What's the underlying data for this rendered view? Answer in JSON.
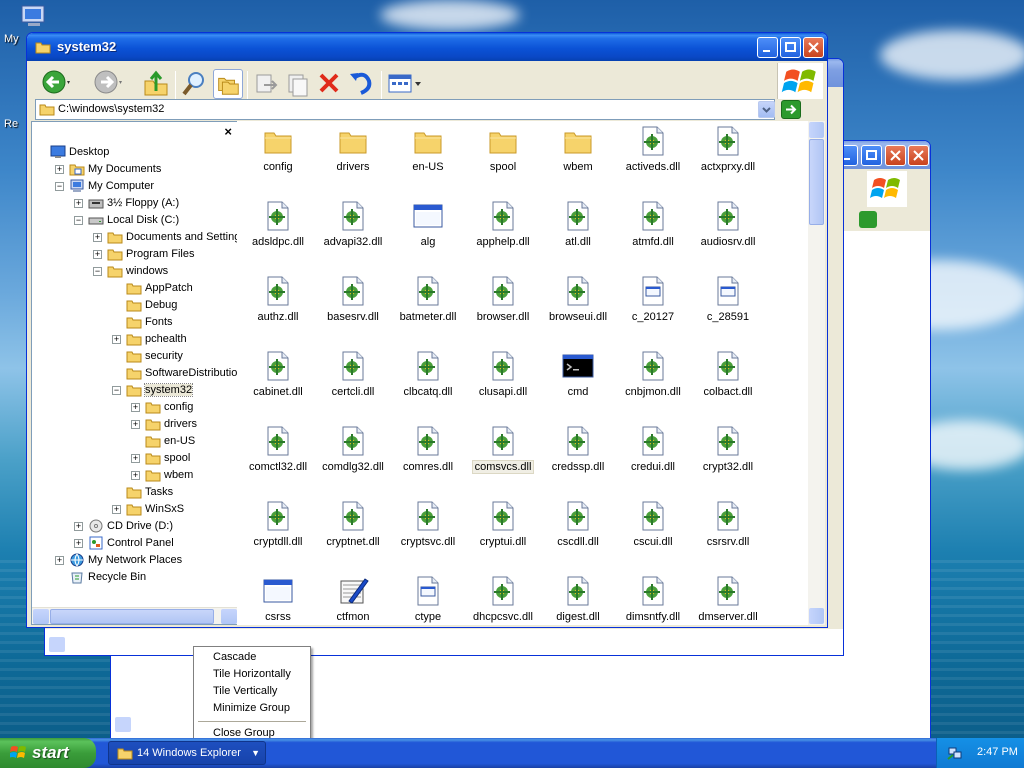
{
  "desktop": {
    "icon_labels": [
      "My",
      "Re"
    ]
  },
  "main_window": {
    "title": "system32",
    "address": "C:\\windows\\system32",
    "folders_close": "×",
    "tree": [
      {
        "label": "Desktop",
        "icon": "desktop-icon",
        "indent": 0,
        "expander": ""
      },
      {
        "label": "My Documents",
        "icon": "my-documents-icon",
        "indent": 1,
        "expander": "+"
      },
      {
        "label": "My Computer",
        "icon": "my-computer-icon",
        "indent": 1,
        "expander": "−"
      },
      {
        "label": "3½ Floppy (A:)",
        "icon": "floppy-drive-icon",
        "indent": 2,
        "expander": "+"
      },
      {
        "label": "Local Disk (C:)",
        "icon": "local-disk-icon",
        "indent": 2,
        "expander": "−"
      },
      {
        "label": "Documents and Settings",
        "icon": "folder-icon",
        "indent": 3,
        "expander": "+"
      },
      {
        "label": "Program Files",
        "icon": "folder-icon",
        "indent": 3,
        "expander": "+"
      },
      {
        "label": "windows",
        "icon": "folder-icon",
        "indent": 3,
        "expander": "−"
      },
      {
        "label": "AppPatch",
        "icon": "folder-icon",
        "indent": 4,
        "expander": ""
      },
      {
        "label": "Debug",
        "icon": "folder-icon",
        "indent": 4,
        "expander": ""
      },
      {
        "label": "Fonts",
        "icon": "folder-icon",
        "indent": 4,
        "expander": ""
      },
      {
        "label": "pchealth",
        "icon": "folder-icon",
        "indent": 4,
        "expander": "+"
      },
      {
        "label": "security",
        "icon": "folder-icon",
        "indent": 4,
        "expander": ""
      },
      {
        "label": "SoftwareDistribution",
        "icon": "folder-icon",
        "indent": 4,
        "expander": ""
      },
      {
        "label": "system32",
        "icon": "folder-icon",
        "indent": 4,
        "expander": "−",
        "selected": true
      },
      {
        "label": "config",
        "icon": "folder-icon",
        "indent": 5,
        "expander": "+"
      },
      {
        "label": "drivers",
        "icon": "folder-icon",
        "indent": 5,
        "expander": "+"
      },
      {
        "label": "en-US",
        "icon": "folder-icon",
        "indent": 5,
        "expander": ""
      },
      {
        "label": "spool",
        "icon": "folder-icon",
        "indent": 5,
        "expander": "+"
      },
      {
        "label": "wbem",
        "icon": "folder-icon",
        "indent": 5,
        "expander": "+"
      },
      {
        "label": "Tasks",
        "icon": "folder-icon",
        "indent": 4,
        "expander": ""
      },
      {
        "label": "WinSxS",
        "icon": "folder-icon",
        "indent": 4,
        "expander": "+"
      },
      {
        "label": "CD Drive (D:)",
        "icon": "cd-drive-icon",
        "indent": 2,
        "expander": "+"
      },
      {
        "label": "Control Panel",
        "icon": "control-panel-icon",
        "indent": 2,
        "expander": "+"
      },
      {
        "label": "My Network Places",
        "icon": "network-places-icon",
        "indent": 1,
        "expander": "+"
      },
      {
        "label": "Recycle Bin",
        "icon": "recycle-bin-icon",
        "indent": 1,
        "expander": ""
      }
    ],
    "files": [
      {
        "name": "config",
        "icon": "folder"
      },
      {
        "name": "drivers",
        "icon": "folder"
      },
      {
        "name": "en-US",
        "icon": "folder"
      },
      {
        "name": "spool",
        "icon": "folder"
      },
      {
        "name": "wbem",
        "icon": "folder"
      },
      {
        "name": "activeds.dll",
        "icon": "dll"
      },
      {
        "name": "actxprxy.dll",
        "icon": "dll"
      },
      {
        "name": "adsldpc.dll",
        "icon": "dll"
      },
      {
        "name": "advapi32.dll",
        "icon": "dll"
      },
      {
        "name": "alg",
        "icon": "app"
      },
      {
        "name": "apphelp.dll",
        "icon": "dll"
      },
      {
        "name": "atl.dll",
        "icon": "dll"
      },
      {
        "name": "atmfd.dll",
        "icon": "dll"
      },
      {
        "name": "audiosrv.dll",
        "icon": "dll"
      },
      {
        "name": "authz.dll",
        "icon": "dll"
      },
      {
        "name": "basesrv.dll",
        "icon": "dll"
      },
      {
        "name": "batmeter.dll",
        "icon": "dll"
      },
      {
        "name": "browser.dll",
        "icon": "dll"
      },
      {
        "name": "browseui.dll",
        "icon": "dll"
      },
      {
        "name": "c_20127",
        "icon": "doc"
      },
      {
        "name": "c_28591",
        "icon": "doc"
      },
      {
        "name": "cabinet.dll",
        "icon": "dll"
      },
      {
        "name": "certcli.dll",
        "icon": "dll"
      },
      {
        "name": "clbcatq.dll",
        "icon": "dll"
      },
      {
        "name": "clusapi.dll",
        "icon": "dll"
      },
      {
        "name": "cmd",
        "icon": "cmd"
      },
      {
        "name": "cnbjmon.dll",
        "icon": "dll"
      },
      {
        "name": "colbact.dll",
        "icon": "dll"
      },
      {
        "name": "comctl32.dll",
        "icon": "dll"
      },
      {
        "name": "comdlg32.dll",
        "icon": "dll"
      },
      {
        "name": "comres.dll",
        "icon": "dll"
      },
      {
        "name": "comsvcs.dll",
        "icon": "dll",
        "highlight": true
      },
      {
        "name": "credssp.dll",
        "icon": "dll"
      },
      {
        "name": "credui.dll",
        "icon": "dll"
      },
      {
        "name": "crypt32.dll",
        "icon": "dll"
      },
      {
        "name": "cryptdll.dll",
        "icon": "dll"
      },
      {
        "name": "cryptnet.dll",
        "icon": "dll"
      },
      {
        "name": "cryptsvc.dll",
        "icon": "dll"
      },
      {
        "name": "cryptui.dll",
        "icon": "dll"
      },
      {
        "name": "cscdll.dll",
        "icon": "dll"
      },
      {
        "name": "cscui.dll",
        "icon": "dll"
      },
      {
        "name": "csrsrv.dll",
        "icon": "dll"
      },
      {
        "name": "csrss",
        "icon": "app"
      },
      {
        "name": "ctfmon",
        "icon": "ctfmon"
      },
      {
        "name": "ctype",
        "icon": "doc"
      },
      {
        "name": "dhcpcsvc.dll",
        "icon": "dll"
      },
      {
        "name": "digest.dll",
        "icon": "dll"
      },
      {
        "name": "dimsntfy.dll",
        "icon": "dll"
      },
      {
        "name": "dmserver.dll",
        "icon": "dll"
      }
    ]
  },
  "taskbar": {
    "start_label": "start",
    "group_label": "14  Windows Explorer",
    "clock": "2:47 PM"
  },
  "context_menu": {
    "items": [
      "Cascade",
      "Tile Horizontally",
      "Tile Vertically",
      "Minimize Group"
    ],
    "close_item": "Close Group"
  }
}
